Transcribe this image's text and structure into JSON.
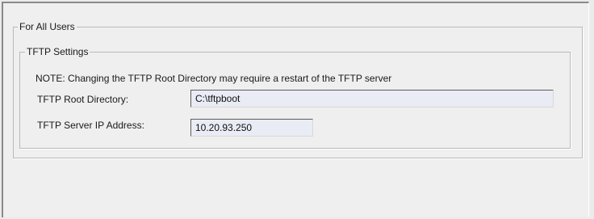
{
  "panel": {
    "outer_group_title": "For All Users",
    "tftp_settings": {
      "group_title": "TFTP Settings",
      "note": "NOTE: Changing the TFTP Root Directory may require a restart of the TFTP server",
      "root_directory": {
        "label": "TFTP Root Directory:",
        "value": "C:\\tftpboot"
      },
      "server_ip": {
        "label": "TFTP Server IP Address:",
        "value": "10.20.93.250"
      }
    }
  }
}
